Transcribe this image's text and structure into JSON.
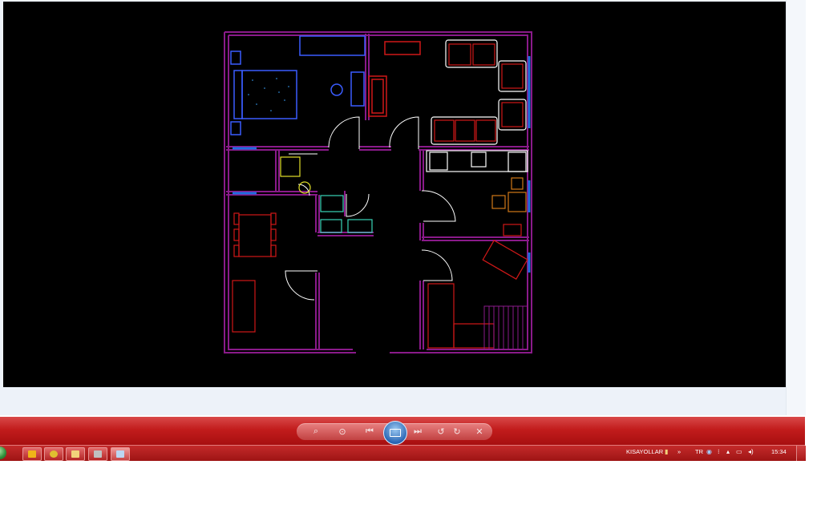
{
  "viewer": {
    "background": "#edf2f9",
    "canvas_background": "#000000"
  },
  "floorplan": {
    "description_colors": {
      "walls": "#8a1a8a",
      "furniture_red": "#d01818",
      "furniture_white": "#ffffff",
      "bed": "#3a5cff",
      "windows": "#1e6fe0",
      "fixtures_yellow": "#e2e02a",
      "fixtures_green": "#38d4b8",
      "chairs_orange": "#d07818"
    }
  },
  "controls": {
    "buttons": [
      {
        "name": "zoom-button",
        "glyph": "⌕"
      },
      {
        "name": "actual-size-button",
        "glyph": "⊙"
      },
      {
        "name": "previous-button",
        "glyph": "⏮"
      },
      {
        "name": "slideshow-button",
        "glyph": "▭"
      },
      {
        "name": "next-button",
        "glyph": "⏭"
      },
      {
        "name": "rotate-ccw-button",
        "glyph": "↺"
      },
      {
        "name": "rotate-cw-button",
        "glyph": "↻"
      },
      {
        "name": "delete-button",
        "glyph": "✕"
      }
    ]
  },
  "taskbar": {
    "apps": [
      {
        "name": "outlook-app",
        "color": "#f0b418"
      },
      {
        "name": "chrome-app",
        "color": "#e0c030"
      },
      {
        "name": "explorer-app",
        "color": "#f2d27a"
      },
      {
        "name": "media-app",
        "color": "#c0c0c0"
      },
      {
        "name": "photo-viewer-app",
        "color": "#bcd6f2"
      }
    ],
    "tray": {
      "shortcuts_label": "KISAYOLLAR",
      "chevron": "»",
      "language": "TR",
      "time": "15:34"
    }
  }
}
